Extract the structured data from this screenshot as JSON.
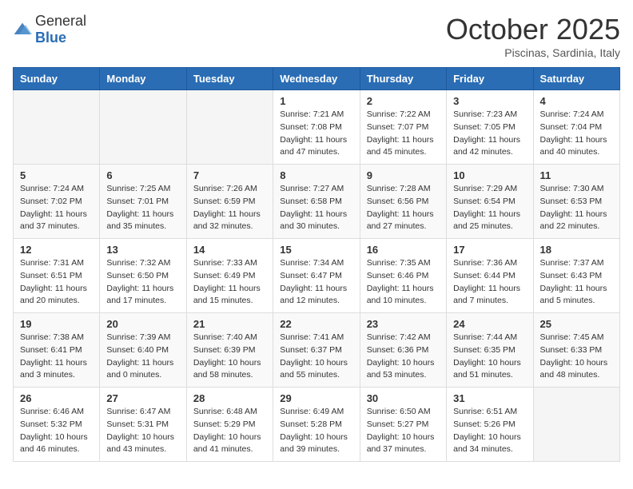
{
  "header": {
    "logo_general": "General",
    "logo_blue": "Blue",
    "month_title": "October 2025",
    "subtitle": "Piscinas, Sardinia, Italy"
  },
  "weekdays": [
    "Sunday",
    "Monday",
    "Tuesday",
    "Wednesday",
    "Thursday",
    "Friday",
    "Saturday"
  ],
  "weeks": [
    [
      {
        "day": "",
        "info": ""
      },
      {
        "day": "",
        "info": ""
      },
      {
        "day": "",
        "info": ""
      },
      {
        "day": "1",
        "info": "Sunrise: 7:21 AM\nSunset: 7:08 PM\nDaylight: 11 hours and 47 minutes."
      },
      {
        "day": "2",
        "info": "Sunrise: 7:22 AM\nSunset: 7:07 PM\nDaylight: 11 hours and 45 minutes."
      },
      {
        "day": "3",
        "info": "Sunrise: 7:23 AM\nSunset: 7:05 PM\nDaylight: 11 hours and 42 minutes."
      },
      {
        "day": "4",
        "info": "Sunrise: 7:24 AM\nSunset: 7:04 PM\nDaylight: 11 hours and 40 minutes."
      }
    ],
    [
      {
        "day": "5",
        "info": "Sunrise: 7:24 AM\nSunset: 7:02 PM\nDaylight: 11 hours and 37 minutes."
      },
      {
        "day": "6",
        "info": "Sunrise: 7:25 AM\nSunset: 7:01 PM\nDaylight: 11 hours and 35 minutes."
      },
      {
        "day": "7",
        "info": "Sunrise: 7:26 AM\nSunset: 6:59 PM\nDaylight: 11 hours and 32 minutes."
      },
      {
        "day": "8",
        "info": "Sunrise: 7:27 AM\nSunset: 6:58 PM\nDaylight: 11 hours and 30 minutes."
      },
      {
        "day": "9",
        "info": "Sunrise: 7:28 AM\nSunset: 6:56 PM\nDaylight: 11 hours and 27 minutes."
      },
      {
        "day": "10",
        "info": "Sunrise: 7:29 AM\nSunset: 6:54 PM\nDaylight: 11 hours and 25 minutes."
      },
      {
        "day": "11",
        "info": "Sunrise: 7:30 AM\nSunset: 6:53 PM\nDaylight: 11 hours and 22 minutes."
      }
    ],
    [
      {
        "day": "12",
        "info": "Sunrise: 7:31 AM\nSunset: 6:51 PM\nDaylight: 11 hours and 20 minutes."
      },
      {
        "day": "13",
        "info": "Sunrise: 7:32 AM\nSunset: 6:50 PM\nDaylight: 11 hours and 17 minutes."
      },
      {
        "day": "14",
        "info": "Sunrise: 7:33 AM\nSunset: 6:49 PM\nDaylight: 11 hours and 15 minutes."
      },
      {
        "day": "15",
        "info": "Sunrise: 7:34 AM\nSunset: 6:47 PM\nDaylight: 11 hours and 12 minutes."
      },
      {
        "day": "16",
        "info": "Sunrise: 7:35 AM\nSunset: 6:46 PM\nDaylight: 11 hours and 10 minutes."
      },
      {
        "day": "17",
        "info": "Sunrise: 7:36 AM\nSunset: 6:44 PM\nDaylight: 11 hours and 7 minutes."
      },
      {
        "day": "18",
        "info": "Sunrise: 7:37 AM\nSunset: 6:43 PM\nDaylight: 11 hours and 5 minutes."
      }
    ],
    [
      {
        "day": "19",
        "info": "Sunrise: 7:38 AM\nSunset: 6:41 PM\nDaylight: 11 hours and 3 minutes."
      },
      {
        "day": "20",
        "info": "Sunrise: 7:39 AM\nSunset: 6:40 PM\nDaylight: 11 hours and 0 minutes."
      },
      {
        "day": "21",
        "info": "Sunrise: 7:40 AM\nSunset: 6:39 PM\nDaylight: 10 hours and 58 minutes."
      },
      {
        "day": "22",
        "info": "Sunrise: 7:41 AM\nSunset: 6:37 PM\nDaylight: 10 hours and 55 minutes."
      },
      {
        "day": "23",
        "info": "Sunrise: 7:42 AM\nSunset: 6:36 PM\nDaylight: 10 hours and 53 minutes."
      },
      {
        "day": "24",
        "info": "Sunrise: 7:44 AM\nSunset: 6:35 PM\nDaylight: 10 hours and 51 minutes."
      },
      {
        "day": "25",
        "info": "Sunrise: 7:45 AM\nSunset: 6:33 PM\nDaylight: 10 hours and 48 minutes."
      }
    ],
    [
      {
        "day": "26",
        "info": "Sunrise: 6:46 AM\nSunset: 5:32 PM\nDaylight: 10 hours and 46 minutes."
      },
      {
        "day": "27",
        "info": "Sunrise: 6:47 AM\nSunset: 5:31 PM\nDaylight: 10 hours and 43 minutes."
      },
      {
        "day": "28",
        "info": "Sunrise: 6:48 AM\nSunset: 5:29 PM\nDaylight: 10 hours and 41 minutes."
      },
      {
        "day": "29",
        "info": "Sunrise: 6:49 AM\nSunset: 5:28 PM\nDaylight: 10 hours and 39 minutes."
      },
      {
        "day": "30",
        "info": "Sunrise: 6:50 AM\nSunset: 5:27 PM\nDaylight: 10 hours and 37 minutes."
      },
      {
        "day": "31",
        "info": "Sunrise: 6:51 AM\nSunset: 5:26 PM\nDaylight: 10 hours and 34 minutes."
      },
      {
        "day": "",
        "info": ""
      }
    ]
  ]
}
